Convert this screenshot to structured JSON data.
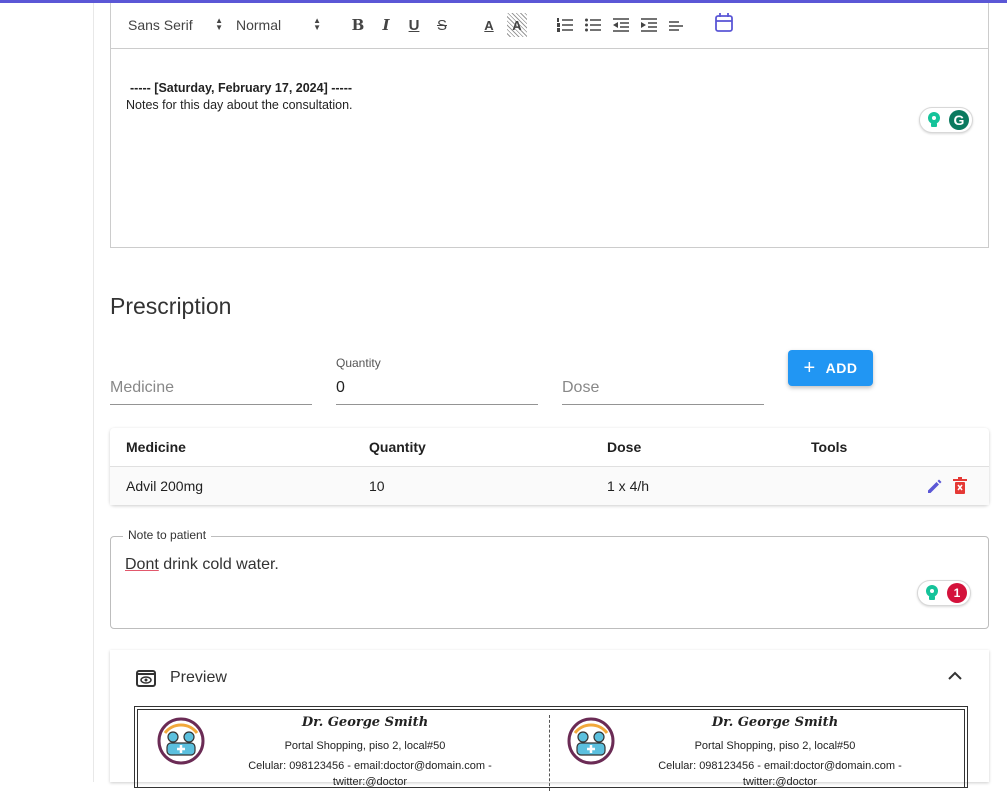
{
  "toolbar": {
    "font_select": "Sans Serif",
    "size_select": "Normal",
    "bold_label": "B",
    "italic_label": "I",
    "underline_label": "U",
    "strike_label": "S",
    "color_label": "A",
    "background_label": "A"
  },
  "editor": {
    "date_line": "----- [Saturday, February 17, 2024] -----",
    "notes_line": "Notes for this day about the consultation."
  },
  "prescription": {
    "title": "Prescription",
    "medicine_placeholder": "Medicine",
    "quantity_label": "Quantity",
    "quantity_value": "0",
    "dose_placeholder": "Dose",
    "add_label": "ADD",
    "columns": [
      "Medicine",
      "Quantity",
      "Dose",
      "Tools"
    ],
    "rows": [
      {
        "medicine": "Advil 200mg",
        "quantity": "10",
        "dose": "1 x 4/h"
      }
    ]
  },
  "note": {
    "legend": "Note to patient",
    "word1": "Dont",
    "rest": " drink cold water.",
    "grammarly_count": "1"
  },
  "preview": {
    "title": "Preview",
    "doctor": "Dr. George Smith",
    "address": "Portal Shopping, piso 2, local#50",
    "contact_line1": "Celular: 098123456 - email:doctor@domain.com -",
    "contact_line2": "twitter:@doctor"
  },
  "colors": {
    "accent": "#2196f3",
    "topbar": "#5b57d6",
    "edit_icon": "#5b57d6",
    "delete_icon": "#e53935",
    "grammarly": "#15c39a"
  }
}
